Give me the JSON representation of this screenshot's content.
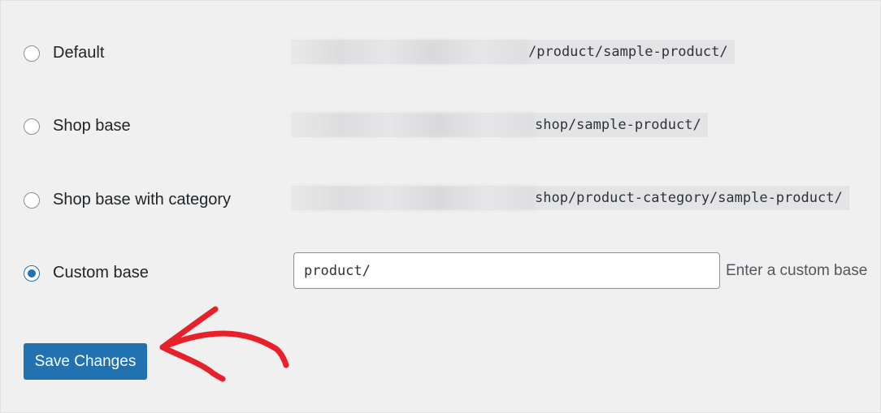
{
  "permalink_options": [
    {
      "label": "Default",
      "path": "/product/sample-product/",
      "checked": false
    },
    {
      "label": "Shop base",
      "path": "shop/sample-product/",
      "checked": false
    },
    {
      "label": "Shop base with category",
      "path": "shop/product-category/sample-product/",
      "checked": false
    },
    {
      "label": "Custom base",
      "checked": true
    }
  ],
  "custom_base": {
    "value": "product/",
    "hint": "Enter a custom base"
  },
  "save_button": {
    "label": "Save Changes"
  },
  "colors": {
    "accent": "#2271b1",
    "annotation_arrow": "#e8202a",
    "background": "#f0f0f1"
  }
}
